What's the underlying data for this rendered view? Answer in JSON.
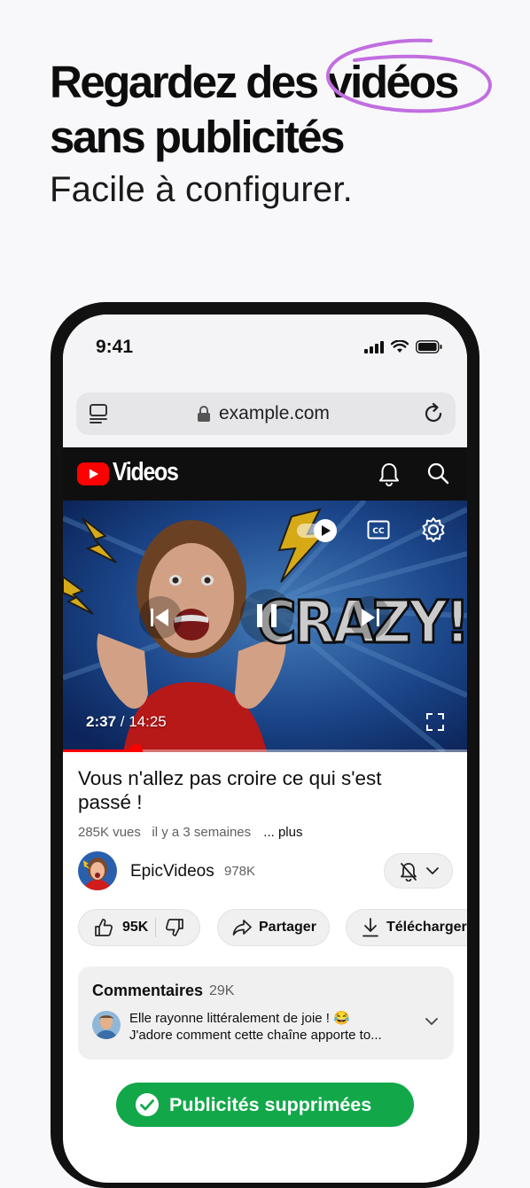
{
  "headline": {
    "line1_a": "Regardez des",
    "line1_b": "vidéos",
    "line2": "sans publicités",
    "subtitle": "Facile à configurer.",
    "accent_color": "#c26ee0"
  },
  "status_bar": {
    "time": "9:41"
  },
  "browser": {
    "url": "example.com"
  },
  "app": {
    "title": "Videos"
  },
  "player": {
    "current_time": "2:37",
    "separator": " / ",
    "duration": "14:25",
    "progress": 0.18,
    "thumbnail_text": "CRAZY!"
  },
  "video": {
    "title": "Vous n'allez pas croire ce qui s'est passé !",
    "views": "285K vues",
    "age": "il y a 3 semaines",
    "more": "... plus"
  },
  "channel": {
    "name": "EpicVideos",
    "subscribers": "978K"
  },
  "actions": {
    "likes": "95K",
    "share": "Partager",
    "download": "Télécharger"
  },
  "comments": {
    "title": "Commentaires",
    "count": "29K",
    "line1": "Elle rayonne littéralement de joie ! 😂",
    "line2": "J'adore comment cette chaîne apporte to..."
  },
  "banner": {
    "label": "Publicités supprimées",
    "color": "#12a84a"
  },
  "icons": [
    "tabs-icon",
    "lock-icon",
    "reload-icon",
    "youtube-logo-icon",
    "bell-icon",
    "search-icon",
    "autoplay-toggle-icon",
    "cc-icon",
    "settings-icon",
    "previous-icon",
    "pause-icon",
    "next-icon",
    "fullscreen-icon",
    "bell-off-icon",
    "chevron-down-icon",
    "thumbs-up-icon",
    "thumbs-down-icon",
    "share-icon",
    "download-icon",
    "check-icon"
  ]
}
